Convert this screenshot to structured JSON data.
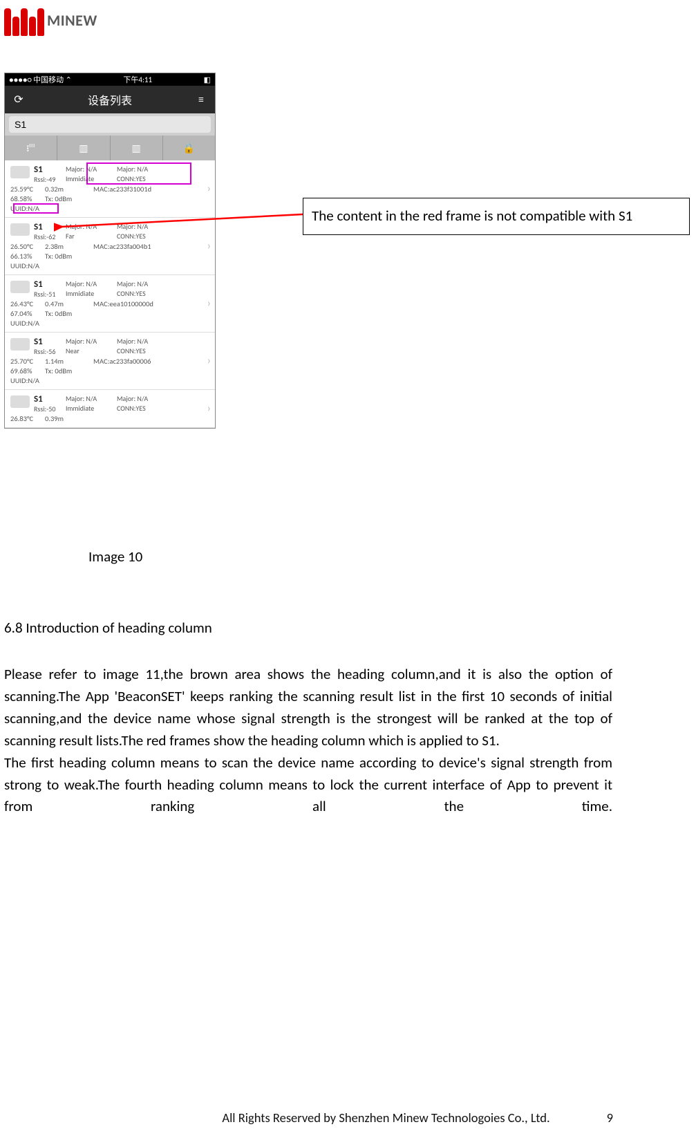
{
  "logo_text": "MINEW",
  "phone": {
    "status_left": "●●●●○ 中国移动 ⌃",
    "status_center": "下午4:11",
    "status_right": "◧",
    "nav": {
      "refresh": "⟳",
      "title": "设备列表",
      "menu": "≡"
    },
    "search_value": "S1",
    "tools": {
      "t1": "᎒ᴵᴵᴵ",
      "t2": "▥",
      "t3": "▥",
      "t4": "🔒"
    },
    "rows": [
      {
        "name": "S1",
        "rssi": "Rssi:-49",
        "temp": "25.59°C",
        "dist": "0.32m",
        "pct": "68.58%",
        "tx": "Tx: 0dBm",
        "uuid": "UUID:N/A",
        "maj1": "Major: N/A",
        "maj2": "Major: N/A",
        "range": "Immidiate",
        "conn": "CONN:YES",
        "mac": "MAC:ac233f31001d",
        "frame1": true,
        "frame2": true
      },
      {
        "name": "S1",
        "rssi": "Rssi:-62",
        "temp": "26.50°C",
        "dist": "2.38m",
        "pct": "66.13%",
        "tx": "Tx: 0dBm",
        "uuid": "UUID:N/A",
        "maj1": "Major: N/A",
        "maj2": "Major: N/A",
        "range": "Far",
        "conn": "CONN:YES",
        "mac": "MAC:ac233fa004b1"
      },
      {
        "name": "S1",
        "rssi": "Rssi:-51",
        "temp": "26.43°C",
        "dist": "0.47m",
        "pct": "67.04%",
        "tx": "Tx: 0dBm",
        "uuid": "UUID:N/A",
        "maj1": "Major: N/A",
        "maj2": "Major: N/A",
        "range": "Immidiate",
        "conn": "CONN:YES",
        "mac": "MAC:eea10100000d"
      },
      {
        "name": "S1",
        "rssi": "Rssi:-56",
        "temp": "25.70°C",
        "dist": "1.14m",
        "pct": "69.68%",
        "tx": "Tx: 0dBm",
        "uuid": "UUID:N/A",
        "maj1": "Major: N/A",
        "maj2": "Major: N/A",
        "range": "Near",
        "conn": "CONN:YES",
        "mac": "MAC:ac233fa00006"
      },
      {
        "name": "S1",
        "rssi": "Rssi:-50",
        "temp": "26.83°C",
        "dist": "0.39m",
        "pct": "",
        "tx": "",
        "uuid": "",
        "maj1": "Major: N/A",
        "maj2": "Major: N/A",
        "range": "Immidiate",
        "conn": "CONN:YES",
        "mac": ""
      }
    ]
  },
  "image_caption": "Image 10",
  "callout_text": "The content in the red frame is not compatible with S1",
  "section_heading": "6.8 Introduction of heading column",
  "body_text_1": "Please refer to image 11,the brown area shows the heading column,and it is also the option of scanning.The App 'BeaconSET' keeps ranking the scanning result list in the first 10 seconds of initial scanning,and the device name whose signal strength is the strongest will be ranked at the top of scanning result lists.The red frames show the heading column which is applied to S1.",
  "body_text_2": "The first heading column means to scan the device name according to device's signal strength from strong to weak.The fourth heading column means to lock the current interface of App to prevent it from ranking all the time.",
  "footer_text": "All Rights Reserved by Shenzhen Minew Technologoies Co., Ltd.",
  "page_num": "9"
}
